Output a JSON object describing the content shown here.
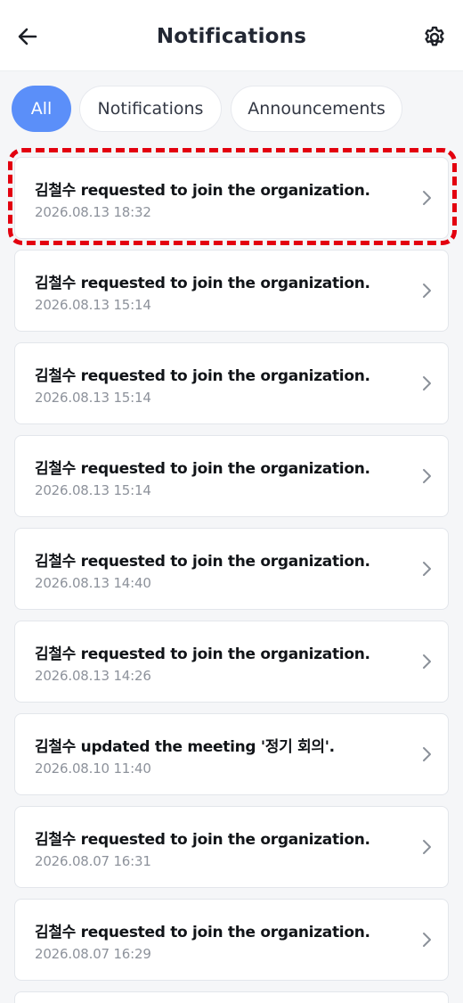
{
  "header": {
    "title": "Notifications",
    "back_icon": "arrow-left-icon",
    "settings_icon": "gear-icon"
  },
  "tabs": [
    {
      "label": "All",
      "active": true
    },
    {
      "label": "Notifications",
      "active": false
    },
    {
      "label": "Announcements",
      "active": false
    }
  ],
  "notifications": [
    {
      "title": "김철수 requested to join the organization.",
      "time": "2026.08.13 18:32"
    },
    {
      "title": "김철수 requested to join the organization.",
      "time": "2026.08.13 15:14"
    },
    {
      "title": "김철수 requested to join the organization.",
      "time": "2026.08.13 15:14"
    },
    {
      "title": "김철수 requested to join the organization.",
      "time": "2026.08.13 15:14"
    },
    {
      "title": "김철수 requested to join the organization.",
      "time": "2026.08.13 14:40"
    },
    {
      "title": "김철수 requested to join the organization.",
      "time": "2026.08.13 14:26"
    },
    {
      "title": "김철수 updated the meeting '정기 회의'.",
      "time": "2026.08.10 11:40"
    },
    {
      "title": "김철수 requested to join the organization.",
      "time": "2026.08.07 16:31"
    },
    {
      "title": "김철수 requested to join the organization.",
      "time": "2026.08.07 16:29"
    }
  ],
  "colors": {
    "accent": "#5b8ff9",
    "highlight": "#e3000f",
    "background": "#f5f6f8"
  }
}
